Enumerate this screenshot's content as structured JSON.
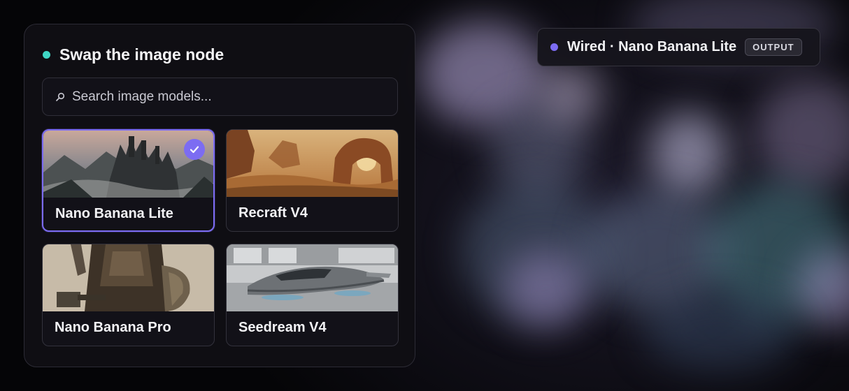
{
  "panel": {
    "title": "Swap the image node",
    "search_placeholder": "Search image models..."
  },
  "models": [
    {
      "label": "Nano Banana Lite",
      "selected": true,
      "thumbnail": "gothic castle on misty mountains"
    },
    {
      "label": "Recraft V4",
      "selected": false,
      "thumbnail": "desert rock arch at sunset"
    },
    {
      "label": "Nano Banana Pro",
      "selected": false,
      "thumbnail": "armored knight with hammer and shield"
    },
    {
      "label": "Seedream V4",
      "selected": false,
      "thumbnail": "futuristic hover car in hangar"
    }
  ],
  "wired_pill": {
    "text": "Wired · Nano Banana Lite",
    "badge": "OUTPUT"
  },
  "colors": {
    "accent": "#7c6cf2",
    "status_teal": "#3fd6c4",
    "panel_bg": "#0f0e14"
  },
  "icons": [
    "search-icon",
    "checkmark-icon"
  ]
}
